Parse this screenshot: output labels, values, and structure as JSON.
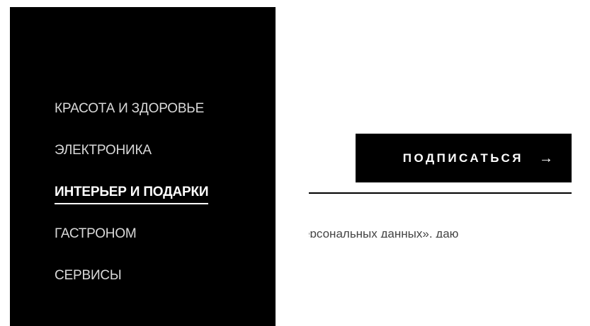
{
  "menu": {
    "items": [
      {
        "label": "КРАСОТА И ЗДОРОВЬЕ",
        "active": false
      },
      {
        "label": "ЭЛЕКТРОНИКА",
        "active": false
      },
      {
        "label": "ИНТЕРЬЕР И ПОДАРКИ",
        "active": true
      },
      {
        "label": "ГАСТРОНОМ",
        "active": false
      },
      {
        "label": "СЕРВИСЫ",
        "active": false
      }
    ]
  },
  "subscribe": {
    "button_label": "ПОДПИСАТЬСЯ",
    "arrow_icon": "arrow-right-icon",
    "arrow_glyph": "→",
    "consent_text": "ерсональных данных», даю"
  },
  "colors": {
    "menu_background": "#000000",
    "button_background": "#000000",
    "active_text": "#ffffff",
    "inactive_text": "#d9d9d9"
  }
}
